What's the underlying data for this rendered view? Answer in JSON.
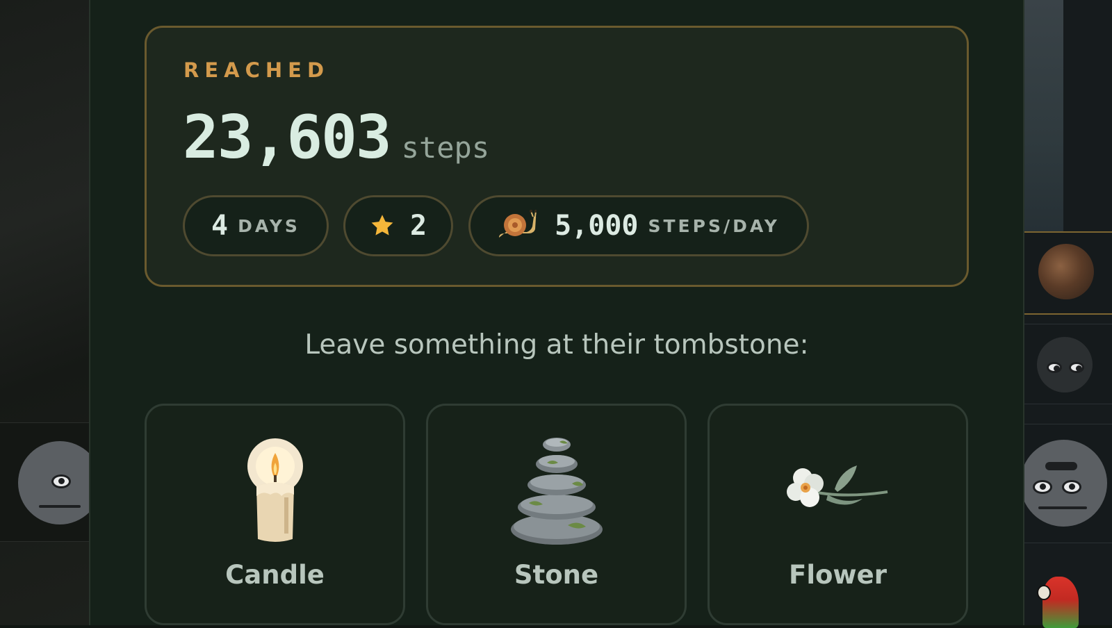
{
  "stats": {
    "label": "REACHED",
    "steps_value": "23,603",
    "steps_unit": "steps",
    "days_value": "4",
    "days_unit": "DAYS",
    "stars_value": "2",
    "pace_value": "5,000",
    "pace_unit": "STEPS/DAY"
  },
  "tombstone": {
    "prompt": "Leave something at their tombstone:",
    "offerings": [
      {
        "label": "Candle",
        "icon": "candle-icon"
      },
      {
        "label": "Stone",
        "icon": "stone-stack-icon"
      },
      {
        "label": "Flower",
        "icon": "flower-icon"
      }
    ]
  },
  "colors": {
    "accent_gold": "#d39a4c",
    "card_border": "#6a5a2e",
    "panel_bg": "#152119",
    "star": "#f4b63a"
  }
}
